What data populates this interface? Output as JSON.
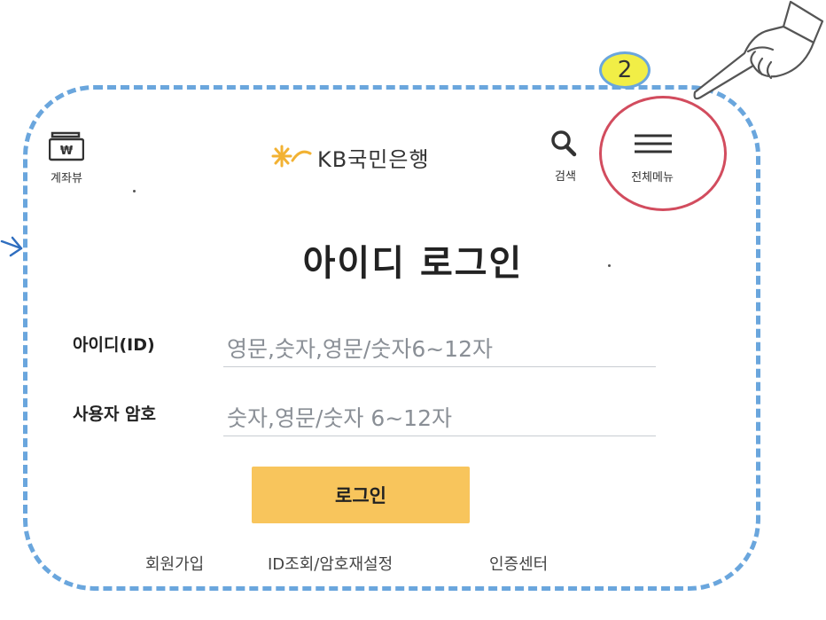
{
  "header": {
    "account_view_label": "계좌뷰",
    "logo_text": "KB국민은행",
    "search_label": "검색",
    "menu_label": "전체메뉴"
  },
  "main": {
    "title": "아이디 로그인",
    "id_field": {
      "label": "아이디(ID)",
      "placeholder": "영문,숫자,영문/숫자6~12자",
      "value": ""
    },
    "password_field": {
      "label": "사용자 암호",
      "placeholder": "숫자,영문/숫자 6~12자",
      "value": ""
    },
    "login_button": "로그인"
  },
  "footer_links": [
    "회원가입",
    "ID조회/암호재설정",
    "인증센터"
  ],
  "annotation": {
    "step_number": "2"
  },
  "icons": [
    "wallet-icon",
    "kb-star-logo-icon",
    "search-icon",
    "hamburger-menu-icon",
    "pointing-hand-icon",
    "arrow-icon"
  ],
  "colors": {
    "accent": "#f8c55c",
    "dashed_border": "#6aa6dd",
    "highlight_circle": "#d24c5e",
    "badge": "#f1ee46",
    "logo_star": "#f2b233"
  }
}
